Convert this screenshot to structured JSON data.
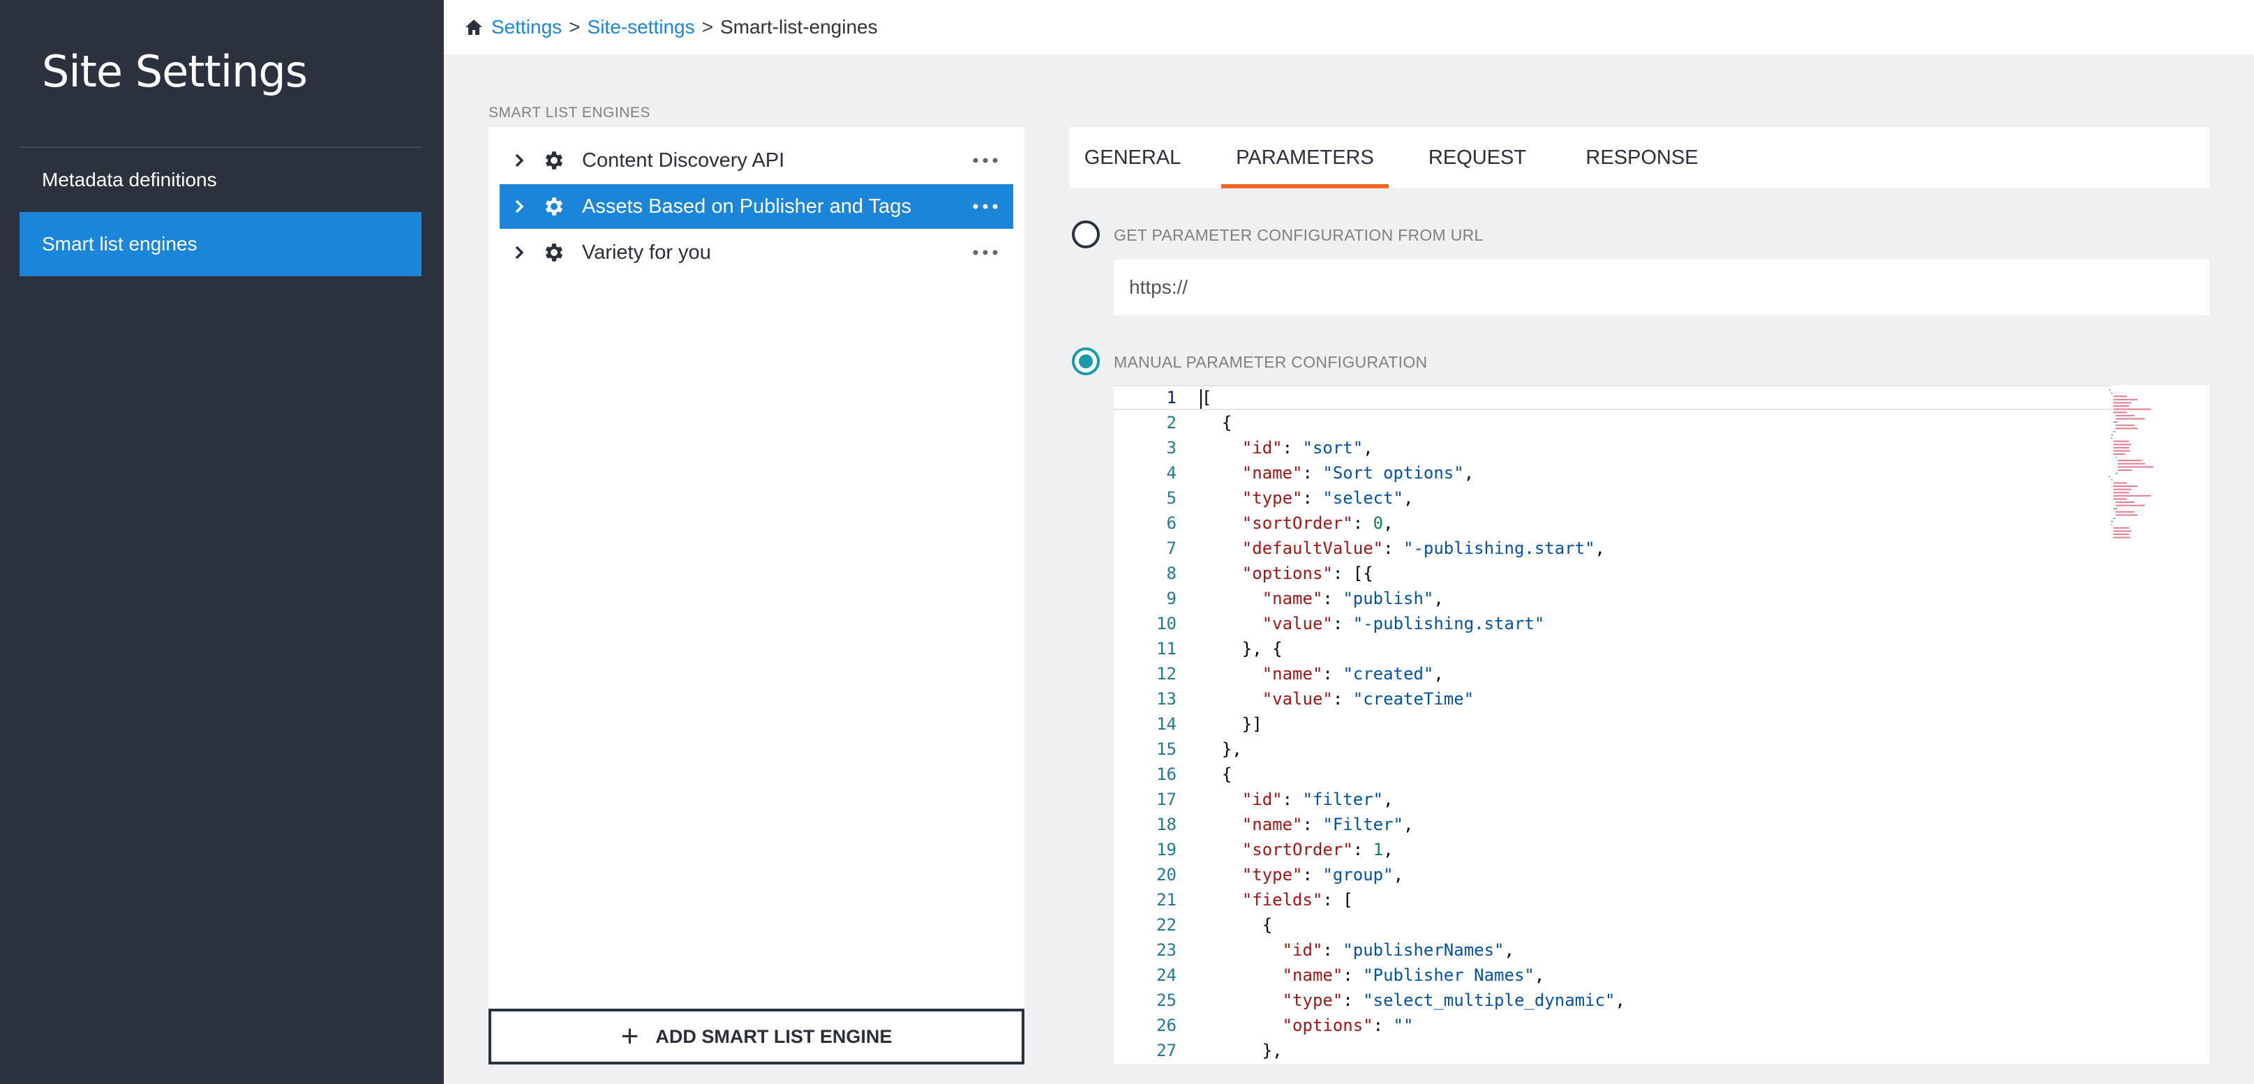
{
  "sidebar": {
    "title": "Site Settings",
    "items": [
      {
        "label": "Metadata definitions",
        "active": false
      },
      {
        "label": "Smart list engines",
        "active": true
      }
    ]
  },
  "breadcrumb": {
    "home_icon": "home-icon",
    "items": [
      "Settings",
      "Site-settings"
    ],
    "current": "Smart-list-engines",
    "separator": ">"
  },
  "engines": {
    "section_label": "SMART LIST ENGINES",
    "items": [
      {
        "label": "Content Discovery API",
        "selected": false
      },
      {
        "label": "Assets Based on Publisher and Tags",
        "selected": true
      },
      {
        "label": "Variety for you",
        "selected": false
      }
    ],
    "add_button": "ADD SMART LIST ENGINE"
  },
  "tabs": [
    {
      "label": "GENERAL",
      "active": false
    },
    {
      "label": "PARAMETERS",
      "active": true
    },
    {
      "label": "REQUEST",
      "active": false
    },
    {
      "label": "RESPONSE",
      "active": false
    }
  ],
  "parameters": {
    "url_option_label": "GET PARAMETER CONFIGURATION FROM URL",
    "url_option_selected": false,
    "url_placeholder": "https://",
    "manual_option_label": "MANUAL PARAMETER CONFIGURATION",
    "manual_option_selected": true
  },
  "editor": {
    "current_line": 1,
    "lines": [
      "[",
      "  {",
      "    \"id\": \"sort\",",
      "    \"name\": \"Sort options\",",
      "    \"type\": \"select\",",
      "    \"sortOrder\": 0,",
      "    \"defaultValue\": \"-publishing.start\",",
      "    \"options\": [{",
      "      \"name\": \"publish\",",
      "      \"value\": \"-publishing.start\"",
      "    }, {",
      "      \"name\": \"created\",",
      "      \"value\": \"createTime\"",
      "    }]",
      "  },",
      "  {",
      "    \"id\": \"filter\",",
      "    \"name\": \"Filter\",",
      "    \"sortOrder\": 1,",
      "    \"type\": \"group\",",
      "    \"fields\": [",
      "      {",
      "        \"id\": \"publisherNames\",",
      "        \"name\": \"Publisher Names\",",
      "        \"type\": \"select_multiple_dynamic\",",
      "        \"options\": \"\"",
      "      },"
    ]
  },
  "colors": {
    "sidebar_bg": "#2c313e",
    "accent_blue": "#1b86d9",
    "tab_underline": "#f26522",
    "radio_teal": "#1b9aaa"
  }
}
